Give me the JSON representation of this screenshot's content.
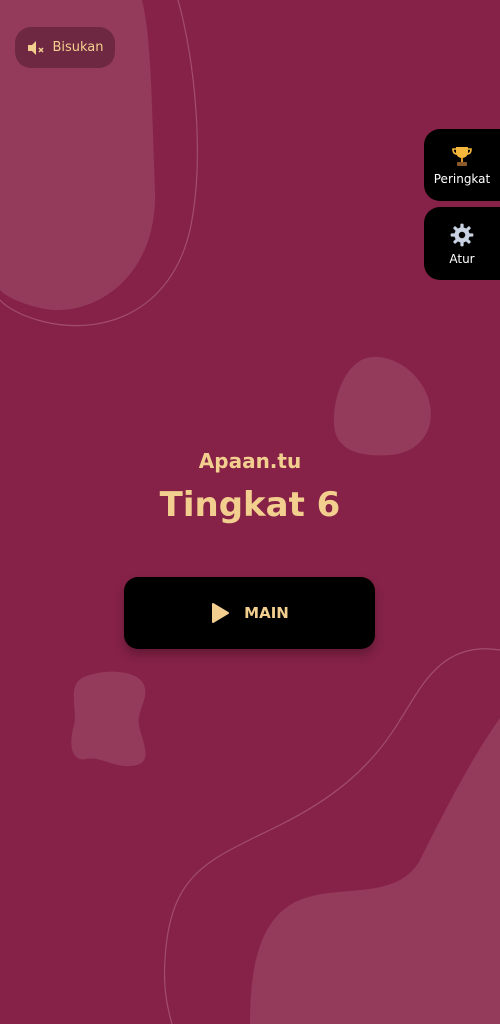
{
  "colors": {
    "background": "#862247",
    "accent": "#f3cf8f",
    "blob": "#973e5e",
    "button": "#000000"
  },
  "top_bar": {
    "mute_label": "Bisukan",
    "mute_icon": "speaker-muted-icon"
  },
  "side_menu": [
    {
      "label": "Peringkat",
      "icon": "trophy-icon"
    },
    {
      "label": "Atur",
      "icon": "gear-icon"
    }
  ],
  "main": {
    "app_name": "Apaan.tu",
    "level": "Tingkat 6",
    "play_label": "MAIN",
    "play_icon": "play-icon"
  }
}
